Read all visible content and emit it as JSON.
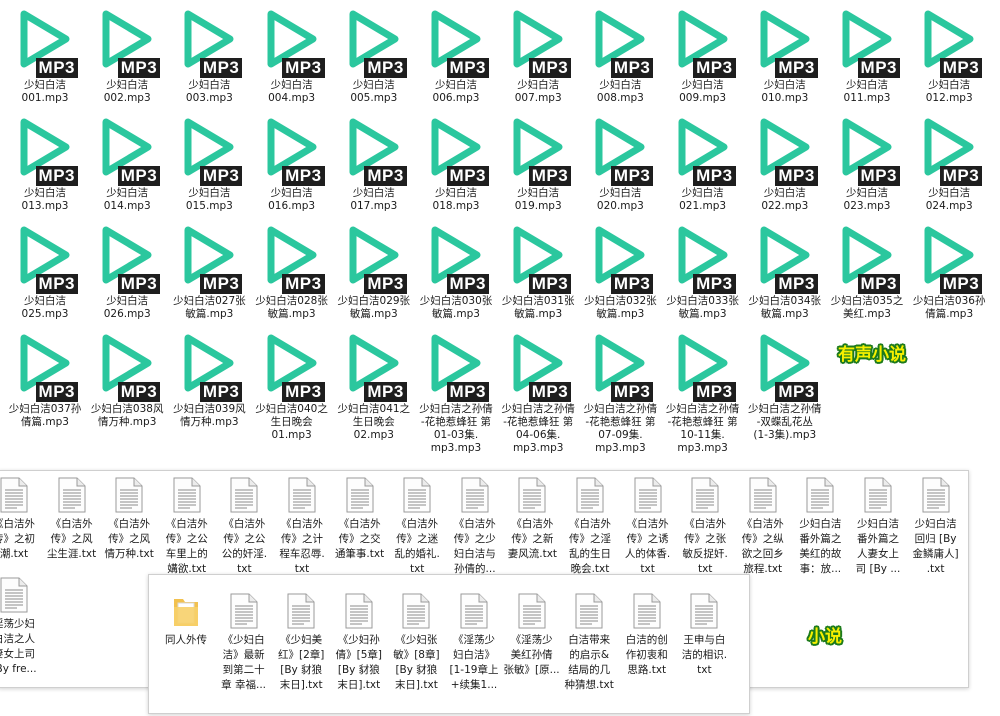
{
  "mp3_files": [
    "少妇白洁001.mp3",
    "少妇白洁002.mp3",
    "少妇白洁003.mp3",
    "少妇白洁004.mp3",
    "少妇白洁005.mp3",
    "少妇白洁006.mp3",
    "少妇白洁007.mp3",
    "少妇白洁008.mp3",
    "少妇白洁009.mp3",
    "少妇白洁010.mp3",
    "少妇白洁011.mp3",
    "少妇白洁012.mp3",
    "少妇白洁013.mp3",
    "少妇白洁014.mp3",
    "少妇白洁015.mp3",
    "少妇白洁016.mp3",
    "少妇白洁017.mp3",
    "少妇白洁018.mp3",
    "少妇白洁019.mp3",
    "少妇白洁020.mp3",
    "少妇白洁021.mp3",
    "少妇白洁022.mp3",
    "少妇白洁023.mp3",
    "少妇白洁024.mp3",
    "少妇白洁025.mp3",
    "少妇白洁026.mp3",
    "少妇白洁027张敏篇.mp3",
    "少妇白洁028张敏篇.mp3",
    "少妇白洁029张敏篇.mp3",
    "少妇白洁030张敏篇.mp3",
    "少妇白洁031张敏篇.mp3",
    "少妇白洁032张敏篇.mp3",
    "少妇白洁033张敏篇.mp3",
    "少妇白洁034张敏篇.mp3",
    "少妇白洁035之美红.mp3",
    "少妇白洁036孙倩篇.mp3",
    "少妇白洁037孙倩篇.mp3",
    "少妇白洁038风情万种.mp3",
    "少妇白洁039风情万种.mp3",
    "少妇白洁040之生日晚会01.mp3",
    "少妇白洁041之生日晚会02.mp3",
    "少妇白洁之孙倩-花艳惹蜂狂 第01-03集.mp3",
    "少妇白洁之孙倩-花艳惹蜂狂 第04-06集.mp3",
    "少妇白洁之孙倩-花艳惹蜂狂 第07-09集.mp3",
    "少妇白洁之孙倩-花艳惹蜂狂 第10-11集.mp3",
    "少妇白洁之孙倩-双蝶乱花丛(1-3集).mp3"
  ],
  "mp3_labels": [
    [
      "少妇白洁",
      "001.mp3"
    ],
    [
      "少妇白洁",
      "002.mp3"
    ],
    [
      "少妇白洁",
      "003.mp3"
    ],
    [
      "少妇白洁",
      "004.mp3"
    ],
    [
      "少妇白洁",
      "005.mp3"
    ],
    [
      "少妇白洁",
      "006.mp3"
    ],
    [
      "少妇白洁",
      "007.mp3"
    ],
    [
      "少妇白洁",
      "008.mp3"
    ],
    [
      "少妇白洁",
      "009.mp3"
    ],
    [
      "少妇白洁",
      "010.mp3"
    ],
    [
      "少妇白洁",
      "011.mp3"
    ],
    [
      "少妇白洁",
      "012.mp3"
    ],
    [
      "少妇白洁",
      "013.mp3"
    ],
    [
      "少妇白洁",
      "014.mp3"
    ],
    [
      "少妇白洁",
      "015.mp3"
    ],
    [
      "少妇白洁",
      "016.mp3"
    ],
    [
      "少妇白洁",
      "017.mp3"
    ],
    [
      "少妇白洁",
      "018.mp3"
    ],
    [
      "少妇白洁",
      "019.mp3"
    ],
    [
      "少妇白洁",
      "020.mp3"
    ],
    [
      "少妇白洁",
      "021.mp3"
    ],
    [
      "少妇白洁",
      "022.mp3"
    ],
    [
      "少妇白洁",
      "023.mp3"
    ],
    [
      "少妇白洁",
      "024.mp3"
    ],
    [
      "少妇白洁",
      "025.mp3"
    ],
    [
      "少妇白洁",
      "026.mp3"
    ],
    [
      "少妇白洁027张",
      "敏篇.mp3"
    ],
    [
      "少妇白洁028张",
      "敏篇.mp3"
    ],
    [
      "少妇白洁029张",
      "敏篇.mp3"
    ],
    [
      "少妇白洁030张",
      "敏篇.mp3"
    ],
    [
      "少妇白洁031张",
      "敏篇.mp3"
    ],
    [
      "少妇白洁032张",
      "敏篇.mp3"
    ],
    [
      "少妇白洁033张",
      "敏篇.mp3"
    ],
    [
      "少妇白洁034张",
      "敏篇.mp3"
    ],
    [
      "少妇白洁035之",
      "美红.mp3"
    ],
    [
      "少妇白洁036孙",
      "倩篇.mp3"
    ],
    [
      "少妇白洁037孙",
      "倩篇.mp3"
    ],
    [
      "少妇白洁038风",
      "情万种.mp3"
    ],
    [
      "少妇白洁039风",
      "情万种.mp3"
    ],
    [
      "少妇白洁040之",
      "生日晚会",
      "01.mp3"
    ],
    [
      "少妇白洁041之",
      "生日晚会",
      "02.mp3"
    ],
    [
      "少妇白洁之孙倩",
      "-花艳惹蜂狂 第",
      "01-03集.",
      "mp3.mp3"
    ],
    [
      "少妇白洁之孙倩",
      "-花艳惹蜂狂 第",
      "04-06集.",
      "mp3.mp3"
    ],
    [
      "少妇白洁之孙倩",
      "-花艳惹蜂狂 第",
      "07-09集.",
      "mp3.mp3"
    ],
    [
      "少妇白洁之孙倩",
      "-花艳惹蜂狂 第",
      "10-11集.",
      "mp3.mp3"
    ],
    [
      "少妇白洁之孙倩",
      "-双蝶乱花丛",
      "(1-3集).mp3"
    ]
  ],
  "mp3_badge": "MP3",
  "stamp_audio": "有声小说",
  "stamp_novel": "小说",
  "txt_row1": [
    [
      "《白洁外",
      "传》之初",
      "潮.txt"
    ],
    [
      "《白洁外",
      "传》之风",
      "尘生涯.txt"
    ],
    [
      "《白洁外",
      "传》之风",
      "情万种.txt"
    ],
    [
      "《白洁外",
      "传》之公",
      "车里上的",
      "媾欲.txt"
    ],
    [
      "《白洁外",
      "传》之公",
      "公的奸淫.",
      "txt"
    ],
    [
      "《白洁外",
      "传》之计",
      "程车忍辱.",
      "txt"
    ],
    [
      "《白洁外",
      "传》之交",
      "通筆事.txt"
    ],
    [
      "《白洁外",
      "传》之迷",
      "乱的婚礼.",
      "txt"
    ],
    [
      "《白洁外",
      "传》之少",
      "妇白洁与",
      "孙倩的..."
    ],
    [
      "《白洁外",
      "传》之新",
      "妻风流.txt"
    ],
    [
      "《白洁外",
      "传》之淫",
      "乱的生日",
      "晚会.txt"
    ],
    [
      "《白洁外",
      "传》之诱",
      "人的体香.",
      "txt"
    ],
    [
      "《白洁外",
      "传》之张",
      "敏反捉奸.",
      "txt"
    ],
    [
      "《白洁外",
      "传》之纵",
      "欲之回乡",
      "旅程.txt"
    ],
    [
      "少妇白洁",
      "番外篇之",
      "美红的故",
      "事：放..."
    ],
    [
      "少妇白洁",
      "番外篇之",
      "人妻女上",
      "司 [By ..."
    ],
    [
      "少妇白洁",
      "回归 [By",
      "金鳞庸人]",
      ".txt"
    ]
  ],
  "txt_partial": [
    "淫荡少妇",
    "白洁之人",
    "妻女上司",
    "[By fre..."
  ],
  "dialog_items": [
    {
      "type": "folder",
      "lines": [
        "同人外传"
      ]
    },
    {
      "type": "txt",
      "lines": [
        "《少妇白",
        "洁》最新",
        "到第二十",
        "章 幸福..."
      ]
    },
    {
      "type": "txt",
      "lines": [
        "《少妇美",
        "红》[2章]",
        "[By 豺狼",
        "末日].txt"
      ]
    },
    {
      "type": "txt",
      "lines": [
        "《少妇孙",
        "倩》[5章]",
        "[By 豺狼",
        "末日].txt"
      ]
    },
    {
      "type": "txt",
      "lines": [
        "《少妇张",
        "敏》[8章]",
        "[By 豺狼",
        "末日].txt"
      ]
    },
    {
      "type": "txt",
      "lines": [
        "《淫荡少",
        "妇白洁》",
        "[1-19章上",
        "+续集1..."
      ]
    },
    {
      "type": "txt",
      "lines": [
        "《淫荡少",
        "美红孙倩",
        "张敏》[原..."
      ]
    },
    {
      "type": "txt",
      "lines": [
        "白洁带来",
        "的启示&",
        "结局的几",
        "种猜想.txt"
      ]
    },
    {
      "type": "txt",
      "lines": [
        "白洁的创",
        "作初衷和",
        "思路.txt"
      ]
    },
    {
      "type": "txt",
      "lines": [
        "王申与白",
        "洁的相识.",
        "txt"
      ]
    }
  ],
  "colors": {
    "play": "#2bc79e",
    "badge_bg": "#1e1e1e",
    "stamp_fill": "#f6f000",
    "stamp_outline": "#1c7a1c",
    "folder": "#f2c14e"
  }
}
